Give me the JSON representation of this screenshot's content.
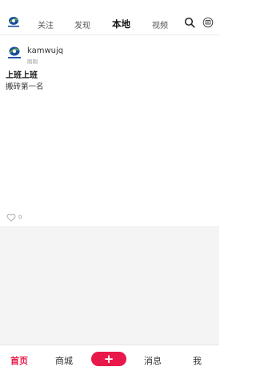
{
  "top_nav": {
    "tabs": [
      {
        "label": "关注",
        "active": false
      },
      {
        "label": "发现",
        "active": false
      },
      {
        "label": "本地",
        "active": true
      },
      {
        "label": "视频",
        "active": false
      }
    ],
    "icons": [
      "logo-icon",
      "search-icon",
      "message-icon"
    ]
  },
  "post": {
    "username": "kamwujq",
    "time": "刚刚",
    "title": "上班上班",
    "body": "搬砖第一名",
    "like_count": "0"
  },
  "bottom_bar": {
    "tabs": [
      {
        "label": "首页",
        "active": true
      },
      {
        "label": "商城",
        "active": false
      },
      {
        "label": "消息",
        "active": false
      },
      {
        "label": "我",
        "active": false
      }
    ],
    "add_label": "+"
  },
  "colors": {
    "accent": "#e8194a",
    "filler": "#f4f4f4",
    "logo_blue": "#1a4ba0",
    "logo_green": "#5db245"
  }
}
